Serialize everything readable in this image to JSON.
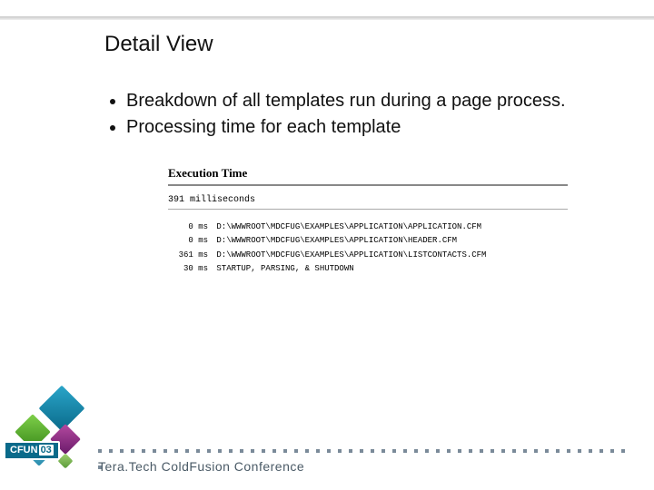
{
  "title": "Detail View",
  "bullets": [
    "Breakdown of all templates run during a page process.",
    "Processing time for each template"
  ],
  "exec": {
    "heading": "Execution Time",
    "total": "391 milliseconds",
    "rows": [
      {
        "time": "0 ms",
        "path": "D:\\WWWROOT\\MDCFUG\\EXAMPLES\\APPLICATION\\APPLICATION.CFM"
      },
      {
        "time": "0 ms",
        "path": "D:\\WWWROOT\\MDCFUG\\EXAMPLES\\APPLICATION\\HEADER.CFM"
      },
      {
        "time": "361 ms",
        "path": "D:\\WWWROOT\\MDCFUG\\EXAMPLES\\APPLICATION\\LISTCONTACTS.CFM"
      },
      {
        "time": "30 ms",
        "path": "STARTUP, PARSING, & SHUTDOWN"
      }
    ]
  },
  "footer": {
    "logo_text": "CFUN",
    "logo_year": "03",
    "conference": "Tera.Tech ColdFusion Conference"
  }
}
